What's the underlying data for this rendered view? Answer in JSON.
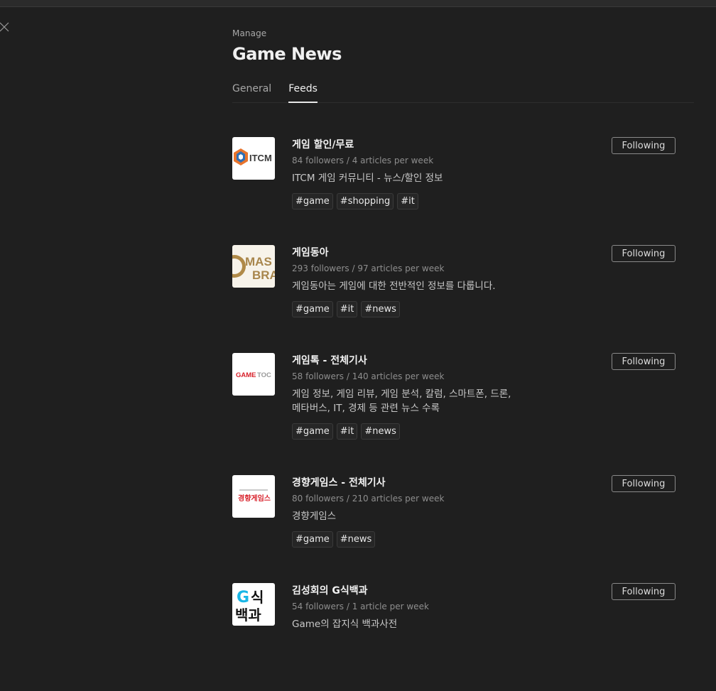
{
  "header": {
    "eyebrow": "Manage",
    "title": "Game News"
  },
  "tabs": [
    {
      "label": "General",
      "active": false
    },
    {
      "label": "Feeds",
      "active": true
    }
  ],
  "feeds": [
    {
      "title": "게임 할인/무료",
      "stats": "84 followers / 4 articles per week",
      "description": "ITCM 게임 커뮤니티 - 뉴스/할인 정보",
      "tags": [
        "#game",
        "#shopping",
        "#it"
      ],
      "button": "Following",
      "logo_text": "ITCM"
    },
    {
      "title": "게임동아",
      "stats": "293 followers / 97 articles per week",
      "description": "게임동아는 게임에 대한 전반적인 정보를 다룹니다.",
      "tags": [
        "#game",
        "#it",
        "#news"
      ],
      "button": "Following",
      "logo_text": "MAS BRA"
    },
    {
      "title": "게임톡 - 전체기사",
      "stats": "58 followers / 140 articles per week",
      "description": "게임 정보, 게임 리뷰, 게임 분석, 칼럼, 스마트폰, 드론, 메타버스, IT, 경제 등 관련 뉴스 수록",
      "tags": [
        "#game",
        "#it",
        "#news"
      ],
      "button": "Following",
      "logo_text": "GAMETOC"
    },
    {
      "title": "경향게임스 - 전체기사",
      "stats": "80 followers / 210 articles per week",
      "description": "경향게임스",
      "tags": [
        "#game",
        "#news"
      ],
      "button": "Following",
      "logo_text": "경향게임스"
    },
    {
      "title": "김성회의 G식백과",
      "stats": "54 followers / 1 article per week",
      "description": "Game의 잡지식 백과사전",
      "tags": [],
      "button": "Following",
      "logo_text": "G식 백과"
    }
  ],
  "colors": {
    "background": "#1f1f1f",
    "gametoc_red": "#d8202a",
    "itcm_orange": "#e8742c",
    "gsik_cyan": "#19b6e6"
  }
}
